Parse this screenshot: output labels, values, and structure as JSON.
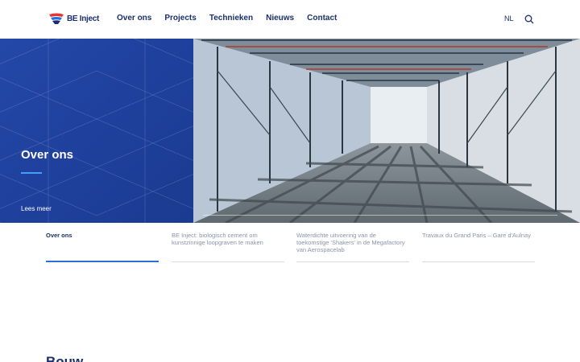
{
  "brand": {
    "name": "BE Inject",
    "logo_colors": [
      "#e8352c",
      "#2a6fe0",
      "#1a2f6b"
    ]
  },
  "nav": {
    "items": [
      {
        "label": "Over ons"
      },
      {
        "label": "Projects"
      },
      {
        "label": "Technieken"
      },
      {
        "label": "Nieuws"
      },
      {
        "label": "Contact"
      }
    ],
    "language": "NL",
    "search_icon": "search-icon"
  },
  "hero": {
    "title": "Over ons",
    "link_label": "Lees meer",
    "panel_color": "#2348a8",
    "accent_color": "#3ea0ff"
  },
  "slides": [
    {
      "label": "Over ons",
      "active": true
    },
    {
      "label": "BE Inject: biologisch cement om kunstzinnige loopgraven te maken",
      "active": false
    },
    {
      "label": "Waterdichte uitvoering van de toekomstige 'Shakers' in de Megafactory van Aerospacelab",
      "active": false
    },
    {
      "label": "Travaux du Grand Paris – Gare d'Aulnay",
      "active": false
    }
  ],
  "section": {
    "heading": "Bouw"
  }
}
